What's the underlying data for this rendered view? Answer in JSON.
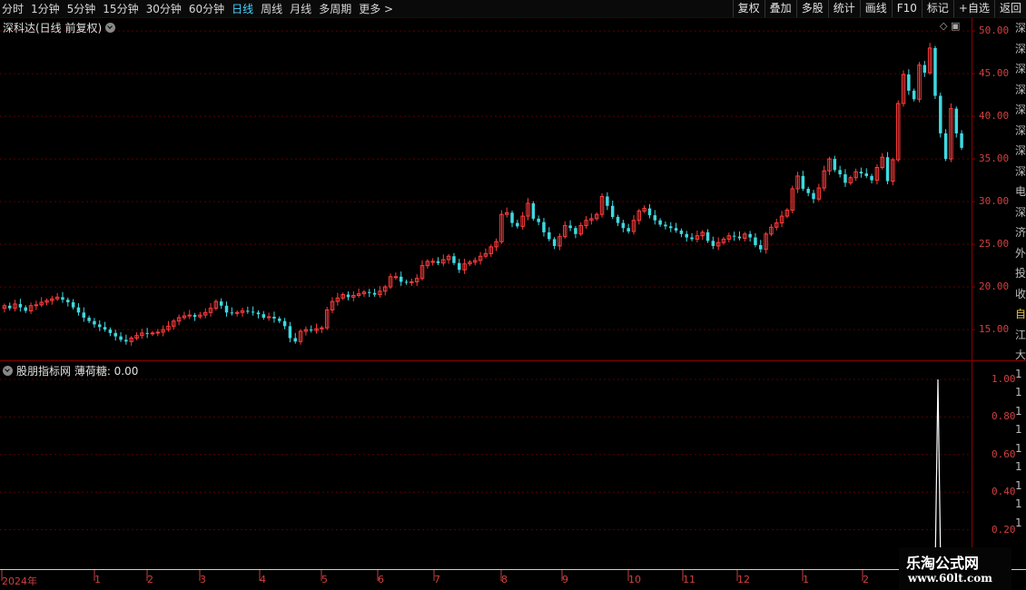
{
  "toolbar": {
    "periods": [
      "分时",
      "1分钟",
      "5分钟",
      "15分钟",
      "30分钟",
      "60分钟",
      "日线",
      "周线",
      "月线",
      "多周期",
      "更多 >"
    ],
    "active": "日线",
    "actions": [
      "复权",
      "叠加",
      "多股",
      "统计",
      "画线",
      "F10",
      "标记",
      "+自选",
      "返回"
    ]
  },
  "main_chart": {
    "title": "深科达(日线 前复权)",
    "yticks": [
      "50.00",
      "45.00",
      "40.00",
      "35.00",
      "30.00",
      "25.00",
      "20.00",
      "15.00"
    ]
  },
  "indicator": {
    "title": "股朋指标网 薄荷糖: 0.00",
    "yticks": [
      "1.00",
      "0.80",
      "0.60",
      "0.40",
      "0.20"
    ]
  },
  "x_axis": {
    "labels": [
      "2024年",
      "1",
      "2",
      "3",
      "4",
      "5",
      "6",
      "7",
      "8",
      "9",
      "10",
      "11",
      "12",
      "1",
      "2"
    ]
  },
  "side_text": [
    "深",
    "深",
    "深",
    "深",
    "深",
    "深",
    "深",
    "深",
    "电",
    "深",
    "济",
    "外",
    "投",
    "收",
    "自",
    "江",
    "大",
    "1",
    "1",
    "1",
    "1",
    "1",
    "1",
    "1",
    "1",
    "1"
  ],
  "watermark": {
    "line1": "乐淘公式网",
    "line2": "www.60lt.com"
  },
  "colors": {
    "up": "#ff3c3c",
    "down": "#3fd8e0",
    "axis": "#8b0000",
    "grid": "#5a0000"
  },
  "chart_data": {
    "type": "candlestick",
    "title": "深科达(日线 前复权)",
    "ylim": [
      11.5,
      51.5
    ],
    "y_ticks": [
      15,
      20,
      25,
      30,
      35,
      40,
      45,
      50
    ],
    "closes": [
      17.8,
      17.5,
      18,
      17.6,
      17.2,
      17.8,
      17.9,
      18.2,
      18.4,
      18.6,
      18.8,
      18.5,
      18.2,
      17.6,
      17,
      16.4,
      16,
      15.6,
      15.3,
      15,
      14.6,
      14.2,
      13.8,
      13.6,
      14,
      14.3,
      14.6,
      14.5,
      14.6,
      14.7,
      15,
      15.4,
      16,
      16.4,
      16.6,
      16.7,
      16.5,
      16.7,
      17,
      17.5,
      18.3,
      17.8,
      17,
      16.9,
      17,
      17.2,
      17.1,
      17,
      16.8,
      16.4,
      16.5,
      16.3,
      16,
      15.4,
      14,
      13.6,
      14.8,
      15,
      14.9,
      15.1,
      15.2,
      17.3,
      18.3,
      18.7,
      19.1,
      18.8,
      19,
      19.2,
      19.4,
      19.3,
      19.1,
      19.5,
      20,
      21.2,
      21.2,
      20.6,
      20.5,
      20.6,
      21,
      22.5,
      23,
      23,
      22.8,
      23.2,
      23.6,
      22.8,
      22,
      22.7,
      22.9,
      23.1,
      23.6,
      23.9,
      24.7,
      25.3,
      28.5,
      28.7,
      27.5,
      27.1,
      28.3,
      29.8,
      28,
      27.6,
      26.4,
      25.6,
      24.8,
      25.9,
      27.2,
      26.9,
      26.2,
      27.2,
      27.8,
      28,
      28.5,
      30.6,
      29.5,
      28.2,
      27.5,
      26.9,
      26.5,
      27.8,
      28.9,
      29.2,
      28.4,
      27.8,
      27.3,
      27.1,
      26.9,
      26.6,
      26.2,
      25.8,
      25.6,
      26,
      26.4,
      25.4,
      24.8,
      25.2,
      25.6,
      26,
      25.9,
      25.7,
      26.2,
      25.8,
      24.9,
      24.4,
      26.2,
      27,
      27.5,
      28.3,
      29,
      31.5,
      33,
      31.5,
      31,
      30.3,
      31.6,
      33.6,
      35,
      33.7,
      33.2,
      32.2,
      32.8,
      33.5,
      33.3,
      33,
      32.5,
      34,
      35.2,
      32.4,
      34.9,
      41.5,
      44.9,
      43,
      42,
      46,
      45.1,
      48,
      42.4,
      38,
      35,
      40.9,
      38,
      36.3
    ],
    "indicator_values": "0.00 everywhere except a single spike to 1.00 near the right end"
  }
}
